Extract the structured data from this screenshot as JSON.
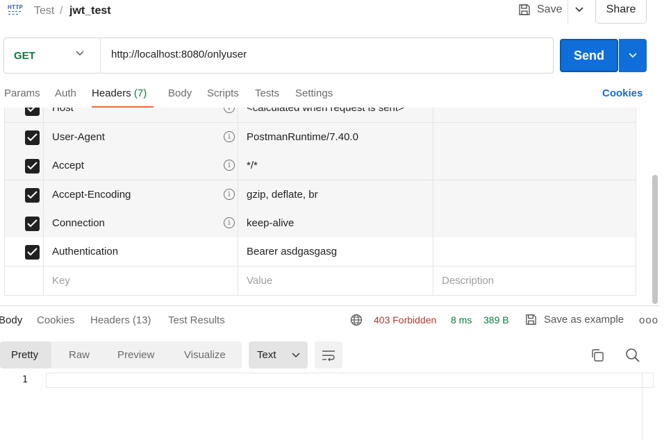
{
  "breadcrumb": {
    "parent": "Test",
    "separator": "/",
    "current": "jwt_test",
    "icon": "http-icon"
  },
  "toolbar": {
    "save_label": "Save",
    "share_label": "Share"
  },
  "request": {
    "method": "GET",
    "url": "http://localhost:8080/onlyuser",
    "send_label": "Send"
  },
  "request_tabs": {
    "params": "Params",
    "auth": "Auth",
    "headers": "Headers",
    "headers_count": "(7)",
    "body": "Body",
    "scripts": "Scripts",
    "tests": "Tests",
    "settings": "Settings",
    "cookies": "Cookies",
    "active": "Headers"
  },
  "headers": {
    "rows": [
      {
        "key": "Host",
        "value": "<calculated when request is sent>",
        "checked": true,
        "info": true
      },
      {
        "key": "User-Agent",
        "value": "PostmanRuntime/7.40.0",
        "checked": true,
        "info": true
      },
      {
        "key": "Accept",
        "value": "*/*",
        "checked": true,
        "info": true
      },
      {
        "key": "Accept-Encoding",
        "value": "gzip, deflate, br",
        "checked": true,
        "info": true
      },
      {
        "key": "Connection",
        "value": "keep-alive",
        "checked": true,
        "info": true
      },
      {
        "key": "Authentication",
        "value": "Bearer asdgasgasg",
        "checked": true,
        "info": false
      }
    ],
    "placeholder": {
      "key": "Key",
      "value": "Value",
      "description": "Description"
    }
  },
  "response_tabs": {
    "body": "Body",
    "cookies": "Cookies",
    "headers": "Headers (13)",
    "test_results": "Test Results",
    "active": "Body"
  },
  "response_status": {
    "code": "403 Forbidden",
    "time": "8 ms",
    "size": "389 B",
    "save_example": "Save as example",
    "more": "ooo"
  },
  "view_modes": {
    "pretty": "Pretty",
    "raw": "Raw",
    "preview": "Preview",
    "visualize": "Visualize",
    "active": "Pretty",
    "format": "Text"
  },
  "editor": {
    "line_number": "1"
  },
  "colors": {
    "accent_blue": "#0f6ed8",
    "method_green": "#0b7a3e",
    "tab_underline": "#f26b3a",
    "error_red": "#b2392f"
  }
}
